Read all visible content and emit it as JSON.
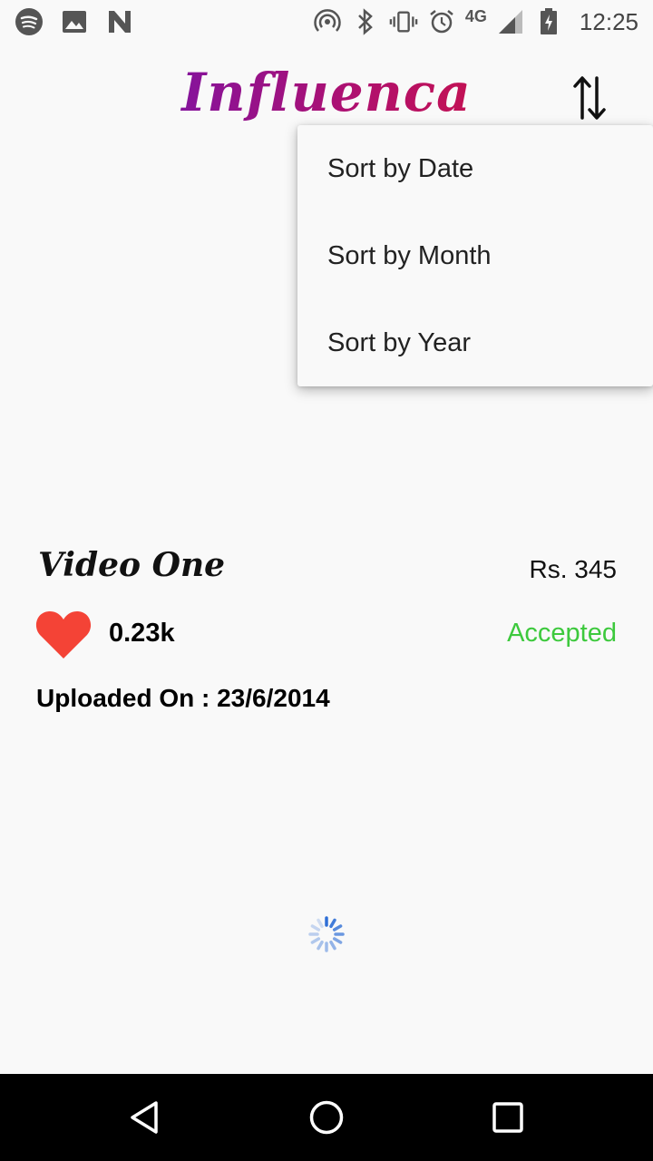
{
  "status_bar": {
    "left_icons": [
      "spotify-icon",
      "image-icon",
      "n-icon"
    ],
    "right_icons": [
      "hotspot-icon",
      "bluetooth-icon",
      "vibrate-icon",
      "alarm-icon"
    ],
    "network": "4G",
    "time": "12:25"
  },
  "app_bar": {
    "title": "Influenca",
    "sort_icon": "sort-arrows-icon"
  },
  "sort_menu": {
    "items": [
      "Sort by Date",
      "Sort by Month",
      "Sort by Year"
    ]
  },
  "video": {
    "title": "Video One",
    "price": "Rs. 345",
    "likes": "0.23k",
    "status": "Accepted",
    "uploaded": "Uploaded On : 23/6/2014"
  },
  "colors": {
    "accepted": "#3dc93d",
    "heart": "#f44336",
    "title_gradient_start": "#5a17c9",
    "title_gradient_end": "#e0142a"
  },
  "nav_bar": {
    "icons": [
      "back-icon",
      "home-icon",
      "recents-icon"
    ]
  }
}
